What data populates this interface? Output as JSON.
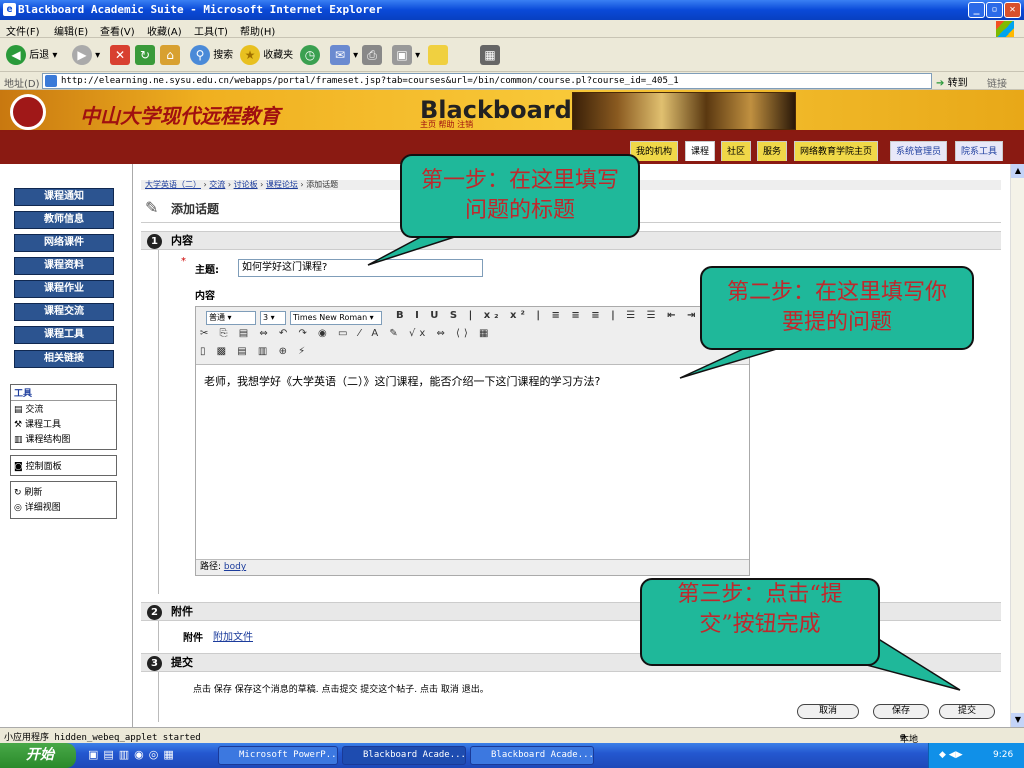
{
  "window": {
    "title": "Blackboard Academic Suite - Microsoft Internet Explorer"
  },
  "menu": [
    "文件(F)",
    "编辑(E)",
    "查看(V)",
    "收藏(A)",
    "工具(T)",
    "帮助(H)"
  ],
  "toolbar": {
    "back": "后退",
    "search": "搜索",
    "favorites": "收藏夹"
  },
  "address": {
    "label": "地址(D)",
    "url": "http://elearning.ne.sysu.edu.cn/webapps/portal/frameset.jsp?tab=courses&url=/bin/common/course.pl?course_id=_405_1",
    "go": "转到",
    "links": "链接"
  },
  "banner": {
    "school": "中山大学现代远程教育",
    "brand": "Blackboard",
    "links": "主页 帮助 注销"
  },
  "nav_tabs": [
    "我的机构",
    "课程",
    "社区",
    "服务",
    "网络教育学院主页",
    "系统管理员",
    "院系工具"
  ],
  "sidebar": {
    "buttons": [
      "课程通知",
      "教师信息",
      "网络课件",
      "课程资料",
      "课程作业",
      "课程交流",
      "课程工具",
      "相关链接"
    ],
    "tools_title": "工具",
    "tools": [
      "交流",
      "课程工具",
      "课程结构图"
    ],
    "control_panel": "控制面板",
    "refresh": "刷新",
    "detail_view": "详细视图"
  },
  "breadcrumb": {
    "items": [
      "大学英语（二）",
      "交流",
      "讨论板",
      "课程论坛"
    ],
    "current": "添加话题"
  },
  "page_title": "添加话题",
  "section1": {
    "num": "1",
    "title": "内容",
    "subject_label": "主题:",
    "subject_value": "如何学好这门课程?",
    "content_label": "内容"
  },
  "editor": {
    "style": "普通",
    "size": "3",
    "font": "Times New Roman",
    "body": "老师，我想学好《大学英语（二）》这门课程，能否介绍一下这门课程的学习方法?",
    "path_label": "路径:",
    "path_value": "body"
  },
  "section2": {
    "num": "2",
    "title": "附件",
    "label": "附件",
    "link": "附加文件"
  },
  "section3": {
    "num": "3",
    "title": "提交",
    "hint": "点击 保存 保存这个消息的草稿. 点击提交 提交这个帖子. 点击 取消 退出。"
  },
  "buttons": {
    "cancel": "取消",
    "save": "保存",
    "submit": "提交"
  },
  "status": {
    "text": "小应用程序 hidden_webeq_applet started",
    "zone": "本地 Intranet"
  },
  "taskbar": {
    "start": "开始",
    "tasks": [
      "Microsoft PowerP...",
      "Blackboard Acade...",
      "Blackboard Acade..."
    ],
    "clock": "9:26"
  },
  "callouts": {
    "step1": "第一步：在这里填写问题的标题",
    "step2": "第二步：在这里填写你要提的问题",
    "step3": "第三步：点击“提交”按钮完成"
  }
}
